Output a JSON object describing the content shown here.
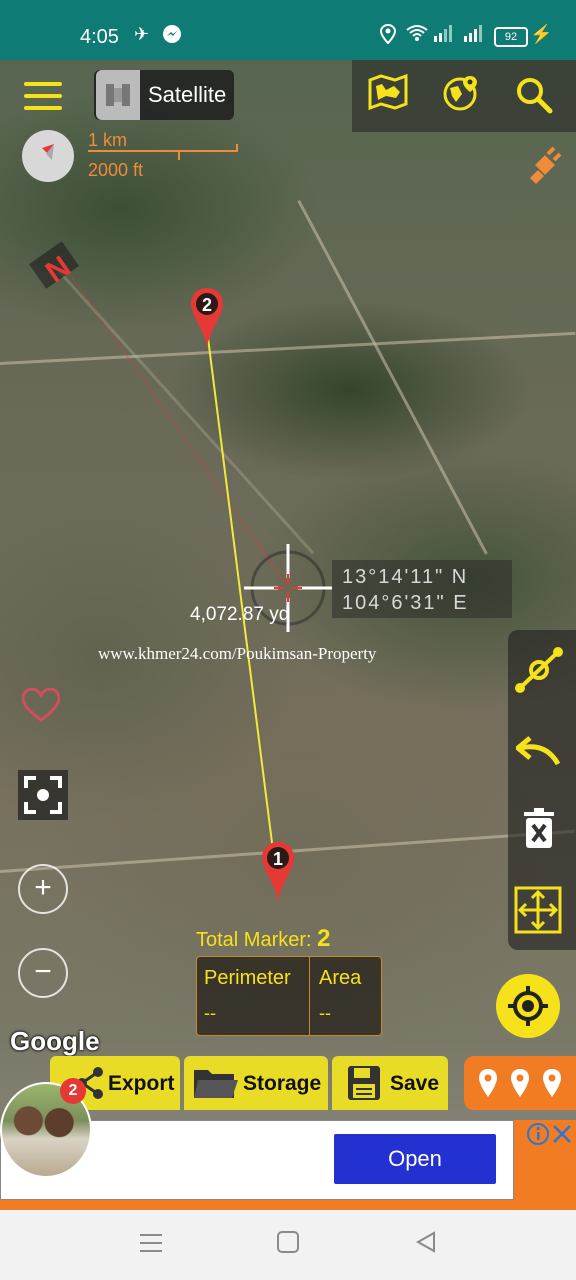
{
  "status_bar": {
    "time": "4:05",
    "battery": "92",
    "icons": [
      "telegram-icon",
      "messenger-icon",
      "location-icon",
      "wifi-icon",
      "signal-icon",
      "signal-icon",
      "battery-icon",
      "charging-icon"
    ]
  },
  "toolbar": {
    "map_type_label": "Satellite",
    "icons": [
      "menu-icon",
      "map-icon",
      "globe-pin-icon",
      "search-icon"
    ]
  },
  "scale": {
    "top": "1 km",
    "bottom": "2000 ft"
  },
  "compass_label": "N",
  "markers": [
    {
      "label": "2"
    },
    {
      "label": "1"
    }
  ],
  "crosshair": {
    "lat": "13°14'11\" N",
    "lon": "104°6'31\" E"
  },
  "distance": "4,072.87 yd",
  "watermark": "www.khmer24.com/Poukimsan-Property",
  "summary": {
    "total_label": "Total Marker:",
    "total_value": "2",
    "perimeter_label": "Perimeter",
    "perimeter_value": "--",
    "area_label": "Area",
    "area_value": "--"
  },
  "attribution": "Google",
  "bottom_actions": {
    "export_label": "Export",
    "storage_label": "Storage",
    "save_label": "Save"
  },
  "ad": {
    "badge_count": "2",
    "open_label": "Open"
  },
  "colors": {
    "accent_yellow": "#f5e21a",
    "orange": "#f17c24",
    "status_bar": "#0e7c74",
    "open_button": "#2431d1",
    "marker_red": "#e53935"
  }
}
